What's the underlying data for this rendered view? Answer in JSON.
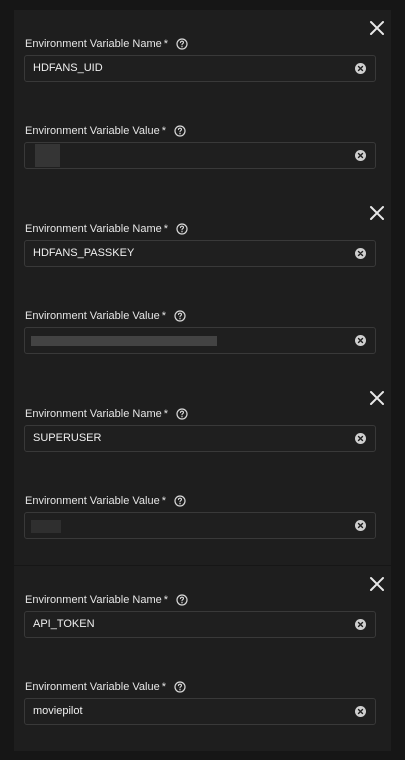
{
  "colors": {
    "page_background": "#161616",
    "card_background": "#1e1e1e",
    "input_border": "#393939",
    "text": "#f0f0f0",
    "icon": "#d9d9d9"
  },
  "icons": {
    "close": "close-icon",
    "help": "help-circle-icon",
    "clear": "clear-circle-icon"
  },
  "env_vars": [
    {
      "name_label": "Environment Variable Name",
      "name_required": "*",
      "name_value": "HDFANS_UID",
      "value_label": "Environment Variable Value",
      "value_required": "*",
      "value_value": ""
    },
    {
      "name_label": "Environment Variable Name",
      "name_required": "*",
      "name_value": "HDFANS_PASSKEY",
      "value_label": "Environment Variable Value",
      "value_required": "*",
      "value_value": ""
    },
    {
      "name_label": "Environment Variable Name",
      "name_required": "*",
      "name_value": "SUPERUSER",
      "value_label": "Environment Variable Value",
      "value_required": "*",
      "value_value": ""
    },
    {
      "name_label": "Environment Variable Name",
      "name_required": "*",
      "name_value": "API_TOKEN",
      "value_label": "Environment Variable Value",
      "value_required": "*",
      "value_value": "moviepilot"
    }
  ]
}
